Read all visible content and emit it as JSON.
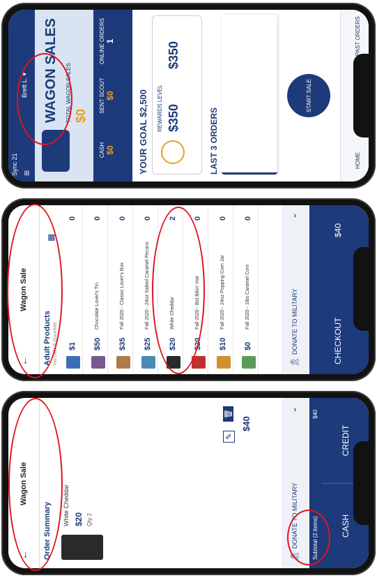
{
  "dashboard": {
    "status_time": "Sync 21",
    "title": "WAGON SALES",
    "user": "Brett L. ▾",
    "stats_title": "TOTAL WAGON SALES",
    "stats_value": "$0",
    "mini": [
      {
        "label": "CASH",
        "value": "$0"
      },
      {
        "label": "SENT SCOUT",
        "value": "$0"
      },
      {
        "label": "ONLINE ORDERS",
        "value": "1"
      }
    ],
    "goal": "YOUR GOAL $2,500",
    "reward_label": "REWARDS LEVEL",
    "reward_value": "$350",
    "reward_value2": "$350",
    "last_orders": "LAST 3 ORDERS",
    "start_sale": "START SALE",
    "bottom_nav": [
      "HOME",
      "PAST ORDERS"
    ]
  },
  "products": {
    "back": "←",
    "title": "Wagon Sale",
    "section": "Adult Products",
    "section_sub": "Via Gifts & Gourmet",
    "items": [
      {
        "price": "$1",
        "name": "",
        "qty": "0",
        "color": "#3d6fb6"
      },
      {
        "price": "$50",
        "name": "Chocolate Lover's Tin",
        "qty": "0",
        "color": "#7a5a8c"
      },
      {
        "price": "$35",
        "name": "Fall 2020 - Classic Lover's Box",
        "qty": "0",
        "color": "#b07a4a"
      },
      {
        "price": "$25",
        "name": "Fall 2020 - 24oz Salted Caramel Pecans",
        "qty": "0",
        "color": "#4a8ab0"
      },
      {
        "price": "$20",
        "name": "White Cheddar",
        "qty": "2",
        "color": "#2a2a2a"
      },
      {
        "price": "$20",
        "name": "Fall 2020 - Bid Bikin' Hat",
        "qty": "0",
        "color": "#c03030"
      },
      {
        "price": "$10",
        "name": "Fall 2020 - 24oz Popping Corn Jar",
        "qty": "0",
        "color": "#d09030"
      },
      {
        "price": "$0",
        "name": "Fall 2020 - 1lbs Caramel Corn",
        "qty": "0",
        "color": "#5a9a5a"
      }
    ],
    "donate": "DONATE TO MILITARY",
    "checkout": "CHECKOUT",
    "total": "$40"
  },
  "summary": {
    "back": "←",
    "title": "Wagon Sale",
    "section": "Order Summary",
    "item_name": "White Cheddar",
    "item_price": "$20",
    "item_qty": "Qty 2",
    "total": "$40",
    "donate": "DONATE TO MILITARY",
    "subtotal": "Subtotal (2 items)",
    "cash": "CASH",
    "credit": "CREDIT",
    "amount": "$40"
  }
}
